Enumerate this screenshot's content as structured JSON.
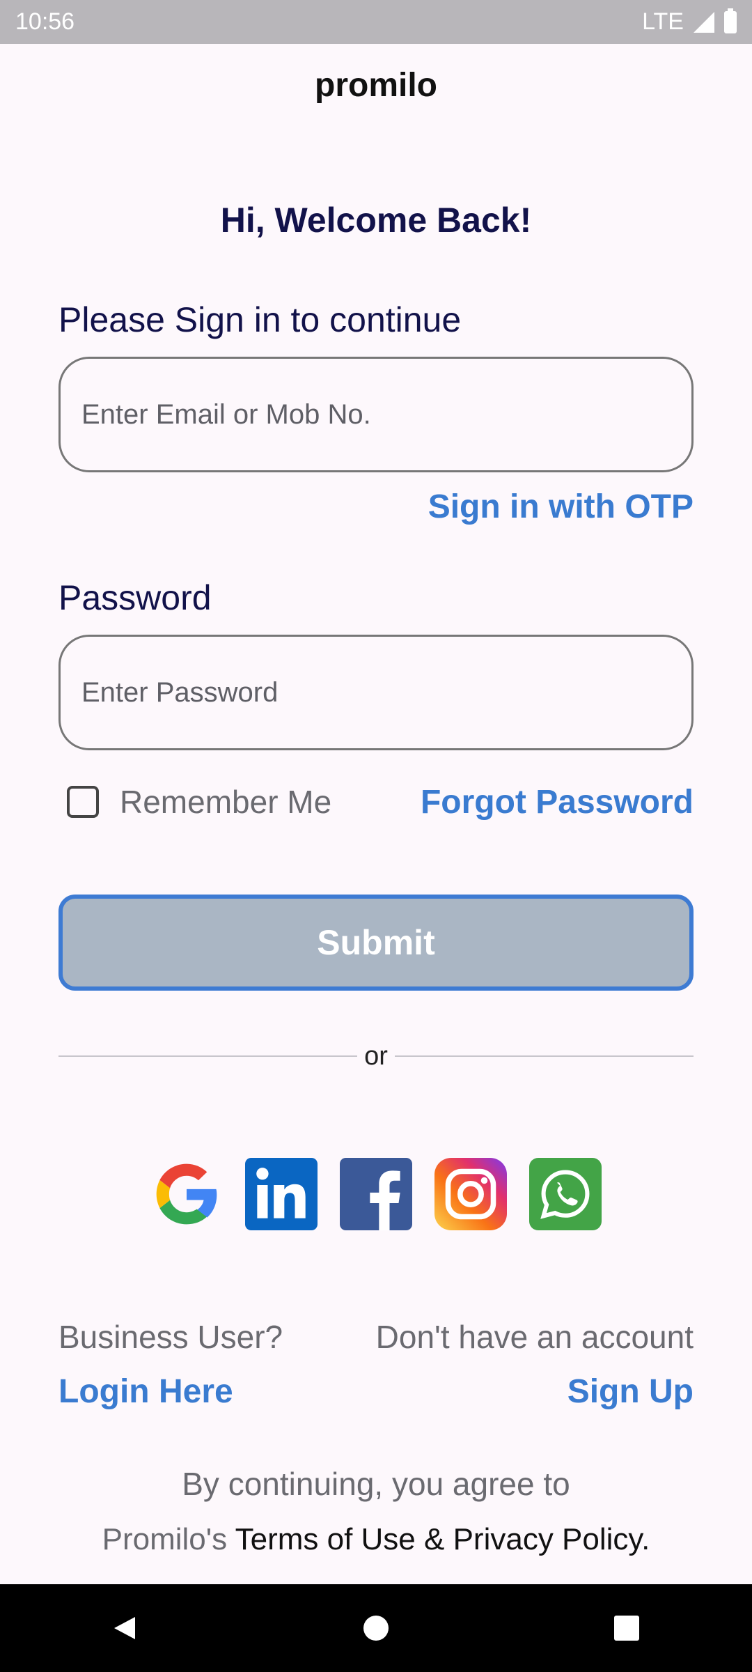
{
  "status_bar": {
    "time": "10:56",
    "network": "LTE",
    "icons": [
      "signal-icon",
      "battery-icon"
    ]
  },
  "app": {
    "title": "promilo"
  },
  "welcome": "Hi, Welcome Back!",
  "signin": {
    "label": "Please Sign in to continue",
    "email_placeholder": "Enter Email or Mob No.",
    "email_value": "",
    "otp_link": "Sign in with OTP"
  },
  "password": {
    "label": "Password",
    "placeholder": "Enter Password",
    "value": ""
  },
  "remember": {
    "label": "Remember Me",
    "checked": false
  },
  "forgot_link": "Forgot Password",
  "submit_label": "Submit",
  "divider_text": "or",
  "social": [
    "google-icon",
    "linkedin-icon",
    "facebook-icon",
    "instagram-icon",
    "whatsapp-icon"
  ],
  "business": {
    "prompt": "Business User?",
    "link": "Login Here"
  },
  "account": {
    "prompt": "Don't have an account",
    "link": "Sign Up"
  },
  "terms": {
    "line1": "By continuing, you agree to",
    "prefix": "Promilo's",
    "policy": "Terms of Use & Privacy Policy."
  },
  "nav": [
    "back-icon",
    "home-icon",
    "recents-icon"
  ],
  "colors": {
    "accent": "#3a7bd0",
    "heading": "#12124a",
    "submit_bg": "#aab6c4",
    "background": "#fdf8fc"
  }
}
